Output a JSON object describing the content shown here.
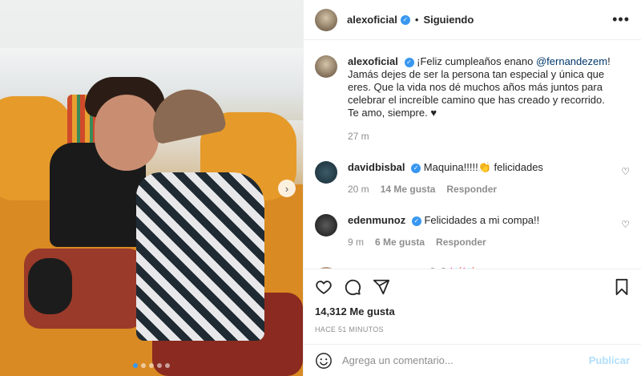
{
  "header": {
    "username": "alexoficial",
    "follow_status": "Siguiendo",
    "separator": "•",
    "more": "•••"
  },
  "caption": {
    "username": "alexoficial",
    "text_before": "¡Feliz cumpleaños enano ",
    "mention": "@fernandezem",
    "text_after": "! Jamás dejes de ser la persona tan especial y única que eres. Que la vida nos dé muchos años más juntos para celebrar el increíble camino que has creado y recorrido.",
    "line2": "Te amo, siempre. ♥",
    "time": "27 m"
  },
  "comments": [
    {
      "username": "davidbisbal",
      "text": "Maquina!!!!!👏 felicidades",
      "time": "20 m",
      "likes": "14 Me gusta",
      "reply": "Responder"
    },
    {
      "username": "edenmunoz",
      "text": "Felicidades a mi compa!!",
      "time": "9 m",
      "likes": "6 Me gusta",
      "reply": "Responder"
    },
    {
      "username": "anetteoficial",
      "text": "😍😍🥳🥳",
      "time": "",
      "likes": "",
      "reply": ""
    }
  ],
  "post": {
    "likes": "14,312 Me gusta",
    "posted_ago": "HACE 51 MINUTOS"
  },
  "composer": {
    "placeholder": "Agrega un comentario...",
    "publish_label": "Publicar"
  },
  "carousel": {
    "slide_count": 5,
    "active_index": 0,
    "next_arrow": "›"
  },
  "colors": {
    "verified": "#3897f0",
    "publish_disabled": "#b2dffc",
    "mention": "#00376b"
  }
}
